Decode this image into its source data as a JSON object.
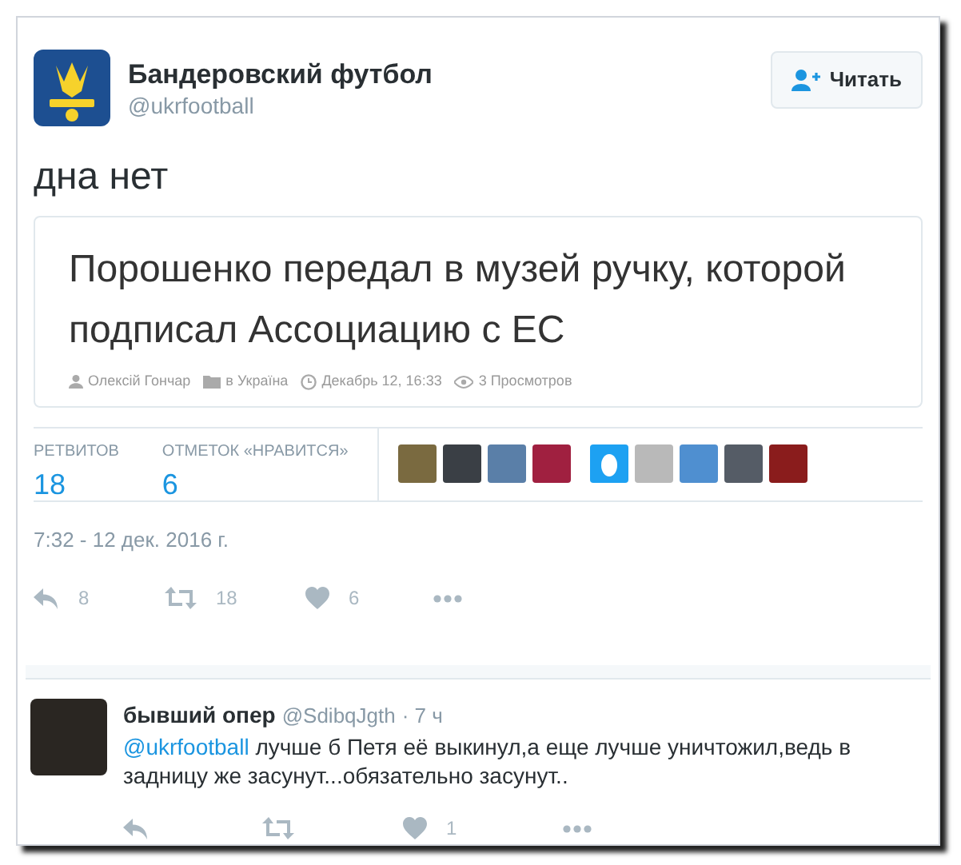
{
  "tweet": {
    "name": "Бандеровский футбол",
    "handle": "@ukrfootball",
    "follow_button": "Читать",
    "text": "дна нет",
    "quote": {
      "title": "Порошенко передал в музей ручку, которой подписал Ассоциацию с ЕС",
      "author": "Олексій Гончар",
      "category": "в Україна",
      "date": "Декабрь 12, 16:33",
      "views": "3 Просмотров"
    },
    "stats": [
      {
        "label": "РЕТВИТОВ",
        "value": "18"
      },
      {
        "label": "ОТМЕТОК «НРАВИТСЯ»",
        "value": "6"
      }
    ],
    "likers": [
      {
        "kind": "photo"
      },
      {
        "kind": "photo"
      },
      {
        "kind": "photo"
      },
      {
        "kind": "photo"
      },
      {
        "kind": "egg"
      },
      {
        "kind": "photo"
      },
      {
        "kind": "photo"
      },
      {
        "kind": "photo"
      },
      {
        "kind": "photo"
      }
    ],
    "timestamp": "7:32 - 12 дек. 2016 г.",
    "actions": [
      {
        "kind": "reply",
        "count": "8"
      },
      {
        "kind": "retweet",
        "count": "18"
      },
      {
        "kind": "like",
        "count": "6"
      },
      {
        "kind": "more"
      }
    ]
  },
  "reply": {
    "name": "бывший опер",
    "handle": "@SdibqJgth",
    "time": "· 7 ч",
    "mention": "@ukrfootball",
    "text": "лучше б Петя её выкинул,а еще лучше уничтожил,ведь в задницу же засунут...обязательно засунут..",
    "actions": [
      {
        "kind": "reply"
      },
      {
        "kind": "retweet"
      },
      {
        "kind": "like",
        "count": "1"
      },
      {
        "kind": "more"
      }
    ]
  }
}
